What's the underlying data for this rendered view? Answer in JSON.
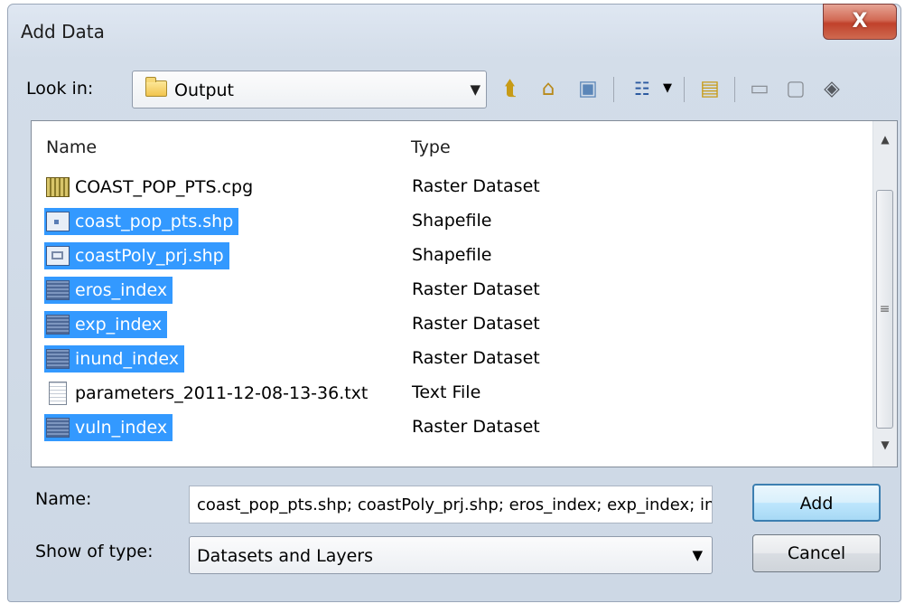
{
  "window": {
    "title": "Add Data",
    "close_glyph": "X"
  },
  "toolbar": {
    "look_in_label": "Look in:",
    "look_in_value": "Output",
    "icons": [
      "folder-up-icon",
      "home-icon",
      "catalog-icon",
      "view-menu-icon",
      "new-folder-icon",
      "disconnect-icon",
      "cube-icon",
      "connect-icon"
    ]
  },
  "file_list": {
    "columns": {
      "name": "Name",
      "type": "Type"
    },
    "rows": [
      {
        "name": "COAST_POP_PTS.cpg",
        "type": "Raster Dataset",
        "icon": "raster-icon",
        "selected": false
      },
      {
        "name": "coast_pop_pts.shp",
        "type": "Shapefile",
        "icon": "point-shapefile-icon",
        "selected": true
      },
      {
        "name": "coastPoly_prj.shp",
        "type": "Shapefile",
        "icon": "polygon-shapefile-icon",
        "selected": true
      },
      {
        "name": "eros_index",
        "type": "Raster Dataset",
        "icon": "raster-icon",
        "selected": true
      },
      {
        "name": "exp_index",
        "type": "Raster Dataset",
        "icon": "raster-icon",
        "selected": true
      },
      {
        "name": "inund_index",
        "type": "Raster Dataset",
        "icon": "raster-icon",
        "selected": true
      },
      {
        "name": "parameters_2011-12-08-13-36.txt",
        "type": "Text File",
        "icon": "text-file-icon",
        "selected": false
      },
      {
        "name": "vuln_index",
        "type": "Raster Dataset",
        "icon": "raster-icon",
        "selected": true
      }
    ]
  },
  "footer": {
    "name_label": "Name:",
    "name_value": "coast_pop_pts.shp; coastPoly_prj.shp; eros_index; exp_index; inund_index; vuln_index",
    "type_label": "Show of type:",
    "type_value": "Datasets and Layers",
    "add_label": "Add",
    "cancel_label": "Cancel"
  }
}
